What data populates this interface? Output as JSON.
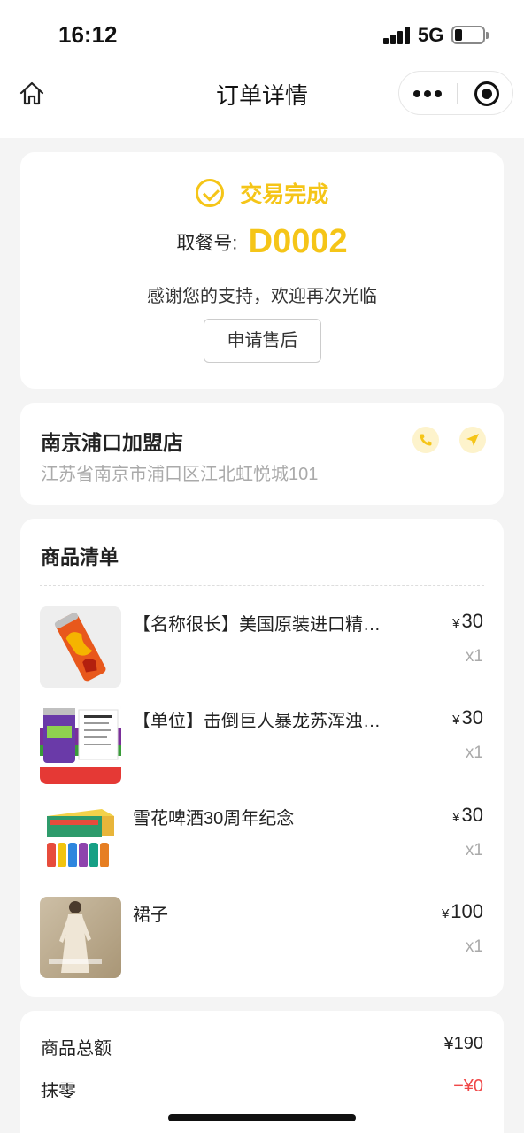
{
  "status_bar": {
    "time": "16:12",
    "network": "5G",
    "battery_level": 0.2
  },
  "nav": {
    "title": "订单详情",
    "icons": [
      "home-icon",
      "more-icon",
      "target-icon"
    ]
  },
  "order_status": {
    "status": "交易完成",
    "pickup_label": "取餐号:",
    "pickup_number": "D0002",
    "thanks": "感谢您的支持，欢迎再次光临",
    "aftersale_label": "申请售后"
  },
  "store": {
    "name": "南京浦口加盟店",
    "address": "江苏省南京市浦口区江北虹悦城101",
    "icons": [
      "phone-icon",
      "navigate-icon"
    ]
  },
  "goods": {
    "title": "商品清单",
    "items": [
      {
        "name": "【名称很长】美国原装进口精酿啤酒",
        "currency": "¥",
        "price": "30",
        "qty": "x1"
      },
      {
        "name": "【单位】击倒巨人暴龙苏浑浊IPA",
        "currency": "¥",
        "price": "30",
        "qty": "x1"
      },
      {
        "name": "雪花啤酒30周年纪念",
        "currency": "¥",
        "price": "30",
        "qty": "x1"
      },
      {
        "name": "裙子",
        "currency": "¥",
        "price": "100",
        "qty": "x1"
      }
    ]
  },
  "summary": {
    "rows": [
      {
        "label": "商品总额",
        "value": "¥190"
      },
      {
        "label": "抹零",
        "value": "−¥0"
      }
    ]
  },
  "colors": {
    "accent": "#f5c518",
    "discount": "#f04848",
    "muted": "#aaaaaa",
    "background": "#f4f4f4"
  }
}
